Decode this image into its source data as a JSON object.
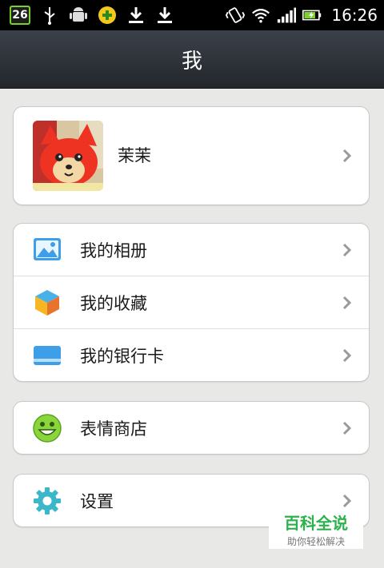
{
  "status_bar": {
    "badge": "26",
    "time": "16:26"
  },
  "header": {
    "title": "我"
  },
  "profile": {
    "name": "茉茉"
  },
  "menu_group_1": [
    {
      "label": "我的相册",
      "icon": "photo-album-icon"
    },
    {
      "label": "我的收藏",
      "icon": "favorites-cube-icon"
    },
    {
      "label": "我的银行卡",
      "icon": "bank-card-icon"
    }
  ],
  "menu_group_2": [
    {
      "label": "表情商店",
      "icon": "smiley-icon"
    }
  ],
  "menu_group_3": [
    {
      "label": "设置",
      "icon": "gear-icon"
    }
  ],
  "watermark": {
    "title": "百科全说",
    "subtitle": "助你轻松解决"
  },
  "colors": {
    "title_bar": "#2e3339",
    "background": "#e8e8e6",
    "card": "#ffffff",
    "watermark_green": "#2bb24c"
  }
}
